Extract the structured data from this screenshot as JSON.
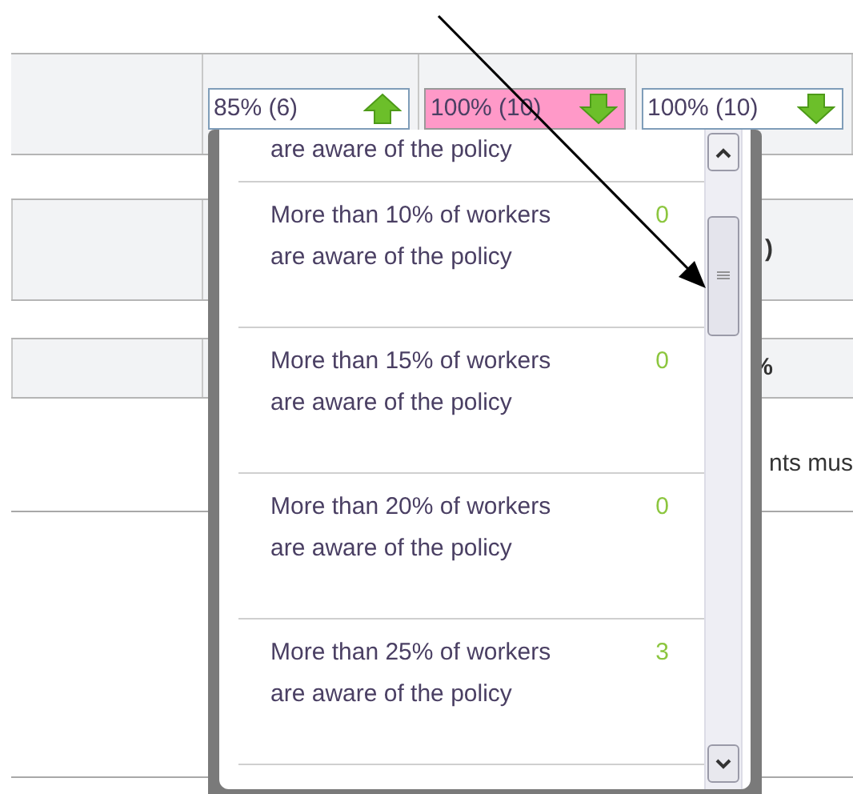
{
  "header_row": {
    "selects": [
      {
        "value": "85% (6)",
        "kind": "up",
        "highlighted": false
      },
      {
        "value": "100% (10)",
        "kind": "down",
        "highlighted": true
      },
      {
        "value": "100% (10)",
        "kind": "down",
        "highlighted": false
      }
    ]
  },
  "column_4": [
    ")",
    "%",
    "nts mus"
  ],
  "dropdown": {
    "items": [
      {
        "label": "are aware of the policy"
      },
      {
        "label": "More than 10% of workers are aware of the policy",
        "count": "0"
      },
      {
        "label": "More than 15% of workers are aware of the policy",
        "count": "0"
      },
      {
        "label": "More than 20% of workers are aware of the policy",
        "count": "0"
      },
      {
        "label": "More than 25% of workers are aware of the policy",
        "count": "3"
      }
    ]
  }
}
